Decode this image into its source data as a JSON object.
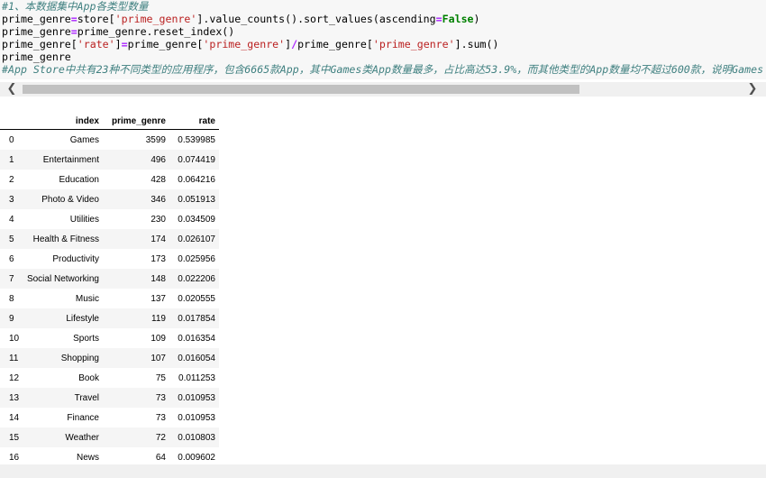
{
  "code": {
    "comment1": "#1、本数据集中App各类型数量",
    "line2": {
      "p1": "prime_genre",
      "p2": "=",
      "p3": "store[",
      "p4": "'prime_genre'",
      "p5": "].value_counts().sort_values(ascending",
      "p6": "=",
      "p7": "False",
      "p8": ")"
    },
    "line3": {
      "p1": "prime_genre",
      "p2": "=",
      "p3": "prime_genre.reset_index()"
    },
    "line4": {
      "p1": "prime_genre[",
      "p2": "'rate'",
      "p3": "]",
      "p4": "=",
      "p5": "prime_genre[",
      "p6": "'prime_genre'",
      "p7": "]",
      "p8": "/",
      "p9": "prime_genre[",
      "p10": "'prime_genre'",
      "p11": "].sum()"
    },
    "line5": "prime_genre",
    "comment2": "#App Store中共有23种不同类型的应用程序，包含6665款App，其中Games类App数量最多，占比高达53.9%，而其他类型的App数量均不超过600款，说明Games"
  },
  "scroll": {
    "left_arrow": "❮",
    "right_arrow": "❯"
  },
  "table": {
    "headers": [
      "",
      "index",
      "prime_genre",
      "rate"
    ],
    "rows": [
      [
        "0",
        "Games",
        "3599",
        "0.539985"
      ],
      [
        "1",
        "Entertainment",
        "496",
        "0.074419"
      ],
      [
        "2",
        "Education",
        "428",
        "0.064216"
      ],
      [
        "3",
        "Photo & Video",
        "346",
        "0.051913"
      ],
      [
        "4",
        "Utilities",
        "230",
        "0.034509"
      ],
      [
        "5",
        "Health & Fitness",
        "174",
        "0.026107"
      ],
      [
        "6",
        "Productivity",
        "173",
        "0.025956"
      ],
      [
        "7",
        "Social Networking",
        "148",
        "0.022206"
      ],
      [
        "8",
        "Music",
        "137",
        "0.020555"
      ],
      [
        "9",
        "Lifestyle",
        "119",
        "0.017854"
      ],
      [
        "10",
        "Sports",
        "109",
        "0.016354"
      ],
      [
        "11",
        "Shopping",
        "107",
        "0.016054"
      ],
      [
        "12",
        "Book",
        "75",
        "0.011253"
      ],
      [
        "13",
        "Travel",
        "73",
        "0.010953"
      ],
      [
        "14",
        "Finance",
        "73",
        "0.010953"
      ],
      [
        "15",
        "Weather",
        "72",
        "0.010803"
      ],
      [
        "16",
        "News",
        "64",
        "0.009602"
      ]
    ]
  }
}
